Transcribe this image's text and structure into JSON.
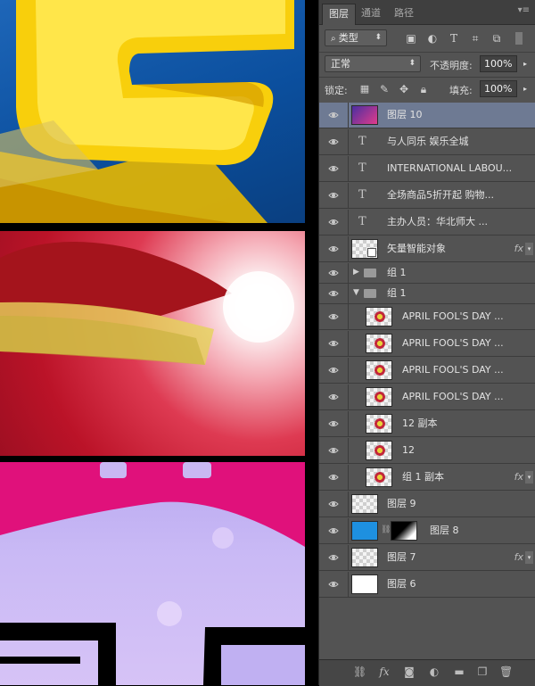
{
  "tabs": [
    "图层",
    "通道",
    "路径"
  ],
  "filter": {
    "label": "类型",
    "icons": [
      "image-filter-icon",
      "adjustment-filter-icon",
      "type-filter-icon",
      "shape-filter-icon",
      "smart-object-filter-icon",
      "filter-toggle-icon"
    ]
  },
  "blend": {
    "mode": "正常",
    "opacity_label": "不透明度:",
    "opacity": "100%"
  },
  "lock": {
    "label": "锁定:",
    "fill_label": "填充:",
    "fill": "100%"
  },
  "layers": [
    {
      "name": "图层 10",
      "type": "pixel",
      "selected": true
    },
    {
      "name": "与人同乐 娱乐全城",
      "type": "text"
    },
    {
      "name": "INTERNATIONAL LABOU...",
      "type": "text"
    },
    {
      "name": "全场商品5折开起 购物...",
      "type": "text"
    },
    {
      "name": "主办人员：华北师大 ...",
      "type": "text"
    },
    {
      "name": "矢量智能对象",
      "type": "smart",
      "fx": true
    },
    {
      "name": "组 1",
      "type": "group-closed"
    },
    {
      "name": "组 1",
      "type": "group-open"
    },
    {
      "name": "APRIL FOOL'S DAY ...",
      "type": "child"
    },
    {
      "name": "APRIL FOOL'S DAY ...",
      "type": "child"
    },
    {
      "name": "APRIL FOOL'S DAY ...",
      "type": "child"
    },
    {
      "name": "APRIL FOOL'S DAY ...",
      "type": "child"
    },
    {
      "name": "12 副本",
      "type": "child"
    },
    {
      "name": "12",
      "type": "child"
    },
    {
      "name": "组 1 副本",
      "type": "child",
      "fx": true
    },
    {
      "name": "图层 9",
      "type": "pixel"
    },
    {
      "name": "图层 8",
      "type": "masked"
    },
    {
      "name": "图层 7",
      "type": "pixel",
      "fx": true
    },
    {
      "name": "图层 6",
      "type": "white"
    }
  ],
  "fx_label": "fx",
  "colors": {
    "panel_bg": "#535353",
    "selected": "#6e7a93",
    "accent_blue": "#1e90e0"
  }
}
